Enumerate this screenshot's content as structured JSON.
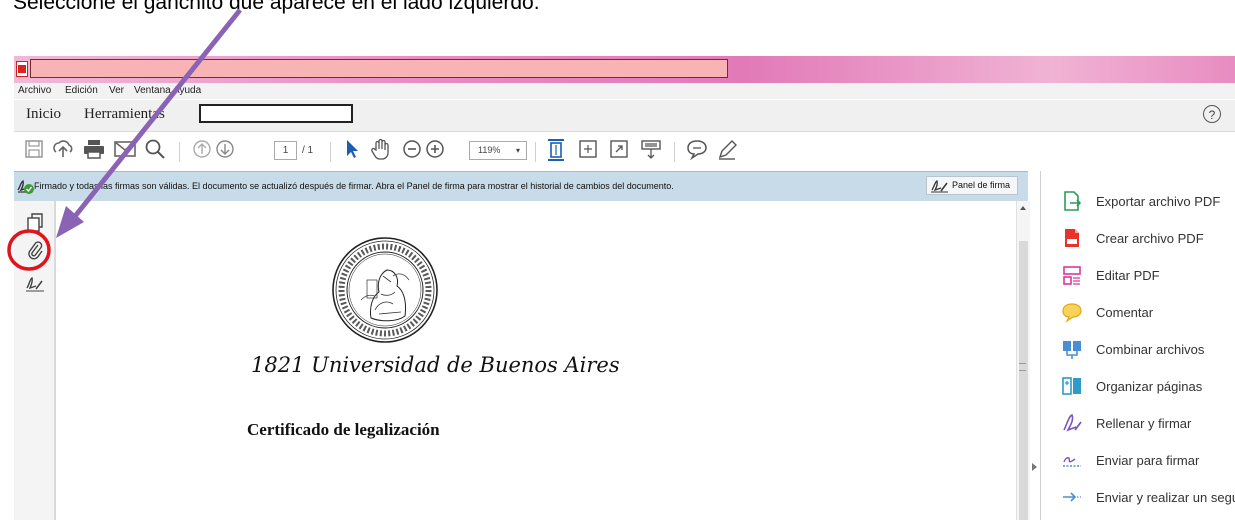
{
  "instruction": "Seleccione el ganchito que aparece en el lado izquierdo.",
  "menu": [
    "Archivo",
    "Edición",
    "Ver",
    "Ventana",
    "Ayuda"
  ],
  "tabs": {
    "home": "Inicio",
    "tools": "Herramientas"
  },
  "help_symbol": "?",
  "toolbar": {
    "page_current": "1",
    "page_total": "/ 1",
    "zoom": "119%"
  },
  "signature_bar": {
    "message": "Firmado y todas las firmas son válidas. El documento se actualizó después de firmar. Abra el Panel de firma para mostrar el historial de cambios del documento.",
    "button": "Panel de firma"
  },
  "document": {
    "university": "1821 Universidad de Buenos Aires",
    "certificate_title": "Certificado de legalización"
  },
  "right_panel": [
    "Exportar archivo PDF",
    "Crear archivo PDF",
    "Editar PDF",
    "Comentar",
    "Combinar archivos",
    "Organizar páginas",
    "Rellenar y firmar",
    "Enviar para firmar",
    "Enviar y realizar un segu"
  ],
  "colors": {
    "annotation_arrow": "#8a63b5",
    "highlight_circle": "#e0141c",
    "signature_bar": "#c7dbe9"
  }
}
